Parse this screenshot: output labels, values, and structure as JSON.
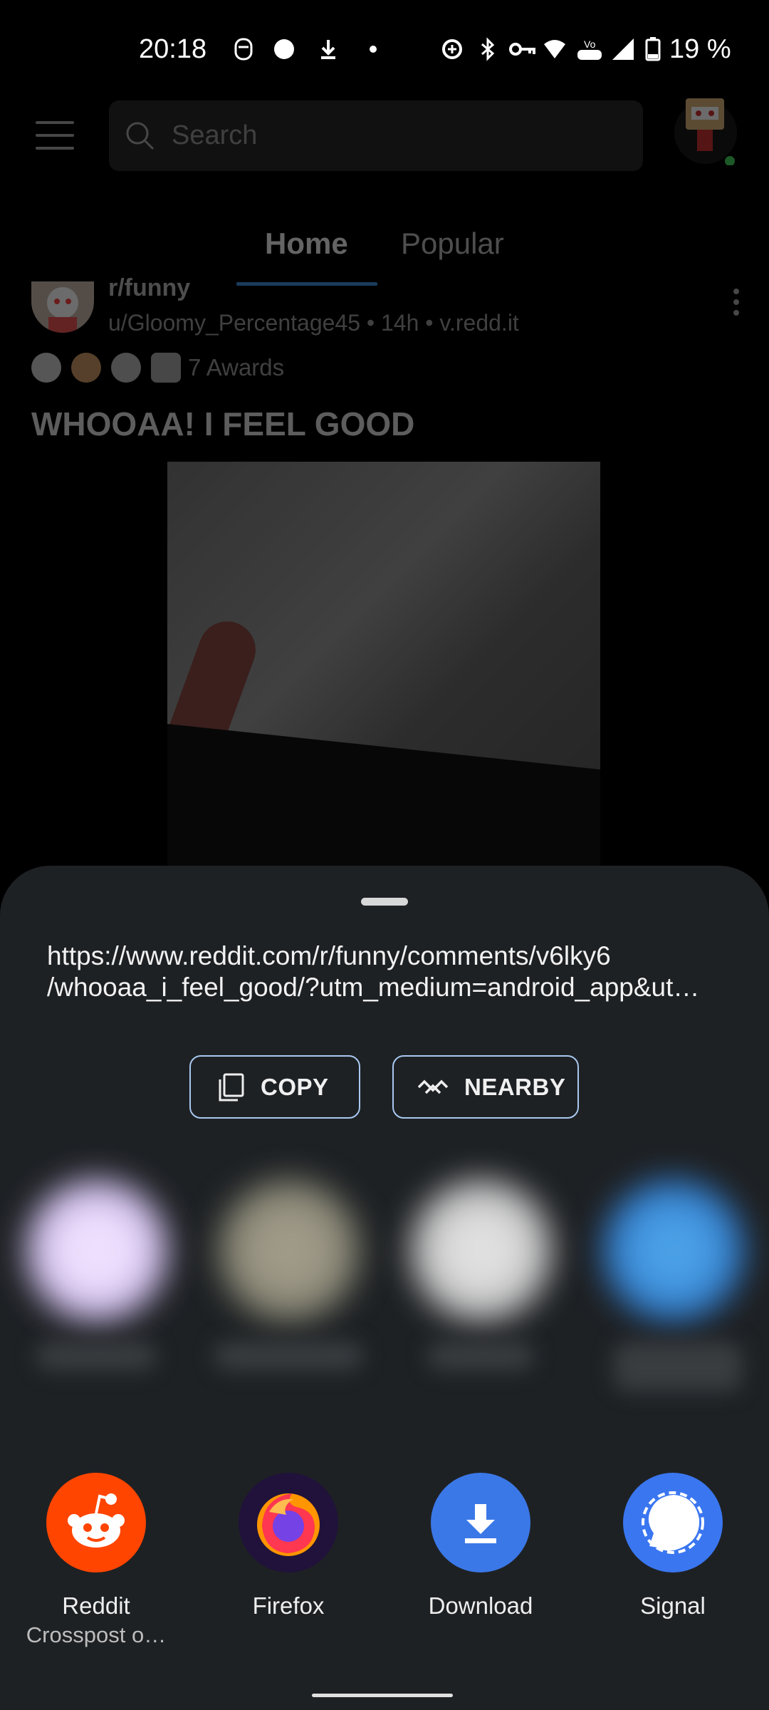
{
  "status_bar": {
    "time": "20:18",
    "battery_percent": "19 %",
    "icons": [
      "notification-face-icon",
      "signal-app-icon",
      "download-icon",
      "dot-icon",
      "data-saver-icon",
      "bluetooth-icon",
      "vpn-key-icon",
      "wifi-icon",
      "volte-icon",
      "cell-signal-icon",
      "battery-icon"
    ]
  },
  "header": {
    "search_placeholder": "Search"
  },
  "tabs": [
    {
      "label": "Home",
      "active": true
    },
    {
      "label": "Popular",
      "active": false
    }
  ],
  "post": {
    "subreddit": "r/funny",
    "meta": "u/Gloomy_Percentage45 • 14h • v.redd.it",
    "awards_label": "7 Awards",
    "title": "WHOOAA! I FEEL GOOD"
  },
  "share_sheet": {
    "url_line1": "https://www.reddit.com/r/funny/comments/v6lky6",
    "url_line2": "/whooaa_i_feel_good/?utm_medium=android_app&ut…",
    "copy_label": "COPY",
    "nearby_label": "NEARBY",
    "apps": [
      {
        "name": "Reddit",
        "sub": "Crosspost o…",
        "color": "#ff4500"
      },
      {
        "name": "Firefox",
        "sub": "",
        "color": "#20123a"
      },
      {
        "name": "Download",
        "sub": "",
        "color": "#3b78e7"
      },
      {
        "name": "Signal",
        "sub": "",
        "color": "#3a76f0"
      }
    ]
  },
  "colors": {
    "accent": "#3e8ede",
    "sheet_bg": "#1e2124",
    "button_border": "#a8c8f0"
  }
}
